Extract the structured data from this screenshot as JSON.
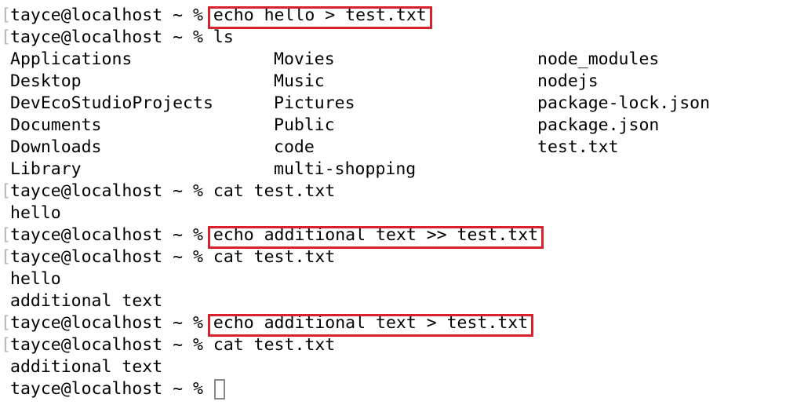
{
  "terminal": {
    "prompt": "tayce@localhost ~ % ",
    "lines": [
      {
        "kind": "command",
        "command": "echo hello > test.txt",
        "highlighted": true
      },
      {
        "kind": "command",
        "command": "ls",
        "highlighted": false
      },
      {
        "kind": "ls",
        "columns": [
          "Applications",
          "Movies",
          "node_modules"
        ]
      },
      {
        "kind": "ls",
        "columns": [
          "Desktop",
          "Music",
          "nodejs"
        ]
      },
      {
        "kind": "ls",
        "columns": [
          "DevEcoStudioProjects",
          "Pictures",
          "package-lock.json"
        ]
      },
      {
        "kind": "ls",
        "columns": [
          "Documents",
          "Public",
          "package.json"
        ]
      },
      {
        "kind": "ls",
        "columns": [
          "Downloads",
          "code",
          "test.txt"
        ]
      },
      {
        "kind": "ls",
        "columns": [
          "Library",
          "multi-shopping",
          ""
        ]
      },
      {
        "kind": "command",
        "command": "cat test.txt",
        "highlighted": false
      },
      {
        "kind": "output",
        "text": "hello"
      },
      {
        "kind": "command",
        "command": "echo additional text >> test.txt",
        "highlighted": true
      },
      {
        "kind": "command",
        "command": "cat test.txt",
        "highlighted": false
      },
      {
        "kind": "output",
        "text": "hello"
      },
      {
        "kind": "output",
        "text": "additional text"
      },
      {
        "kind": "command",
        "command": "echo additional text > test.txt",
        "highlighted": true
      },
      {
        "kind": "command",
        "command": "cat test.txt",
        "highlighted": false
      },
      {
        "kind": "output",
        "text": "additional text"
      },
      {
        "kind": "current",
        "command": ""
      }
    ],
    "highlight_color": "#d8222b",
    "bracket_glyph": "["
  }
}
